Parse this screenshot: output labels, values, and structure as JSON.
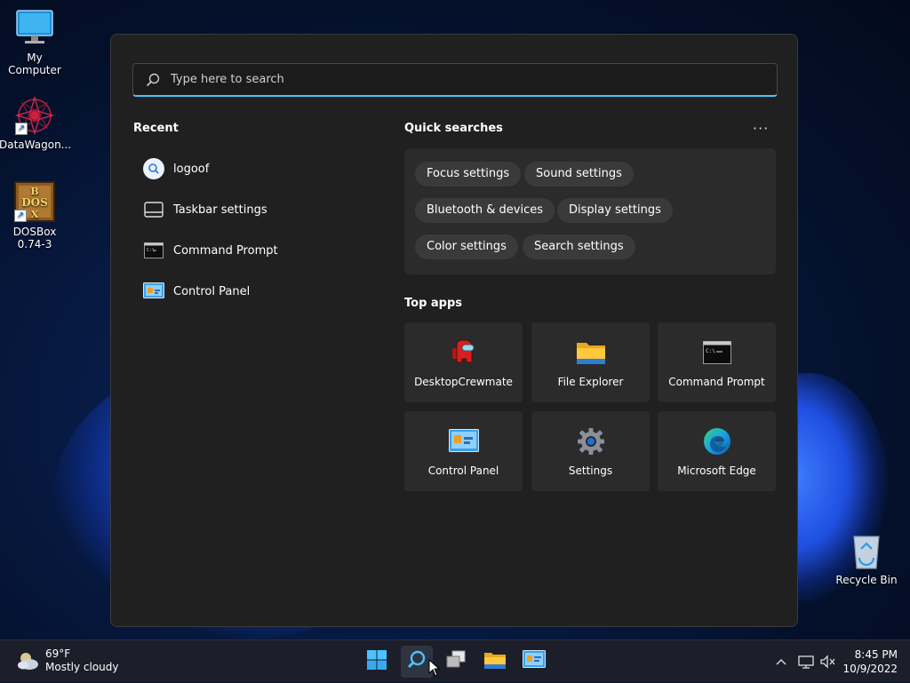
{
  "desktop": {
    "icons": [
      {
        "label": "My Computer"
      },
      {
        "label": "DataWagon..."
      },
      {
        "label": "DOSBox 0.74-3"
      },
      {
        "label": "Recycle Bin"
      }
    ],
    "dosbox_logo_letters": "BDOSX"
  },
  "search": {
    "placeholder": "Type here to search"
  },
  "recent": {
    "title": "Recent",
    "items": [
      {
        "label": "logoof",
        "icon": "search-icon"
      },
      {
        "label": "Taskbar settings",
        "icon": "taskbar-icon"
      },
      {
        "label": "Command Prompt",
        "icon": "command-prompt-icon"
      },
      {
        "label": "Control Panel",
        "icon": "control-panel-icon"
      }
    ]
  },
  "quick_searches": {
    "title": "Quick searches",
    "more": "···",
    "chips": [
      "Focus settings",
      "Sound settings",
      "Bluetooth & devices",
      "Display settings",
      "Color settings",
      "Search settings"
    ]
  },
  "top_apps": {
    "title": "Top apps",
    "apps": [
      {
        "label": "DesktopCrewmate",
        "icon": "crewmate-icon"
      },
      {
        "label": "File Explorer",
        "icon": "folder-icon"
      },
      {
        "label": "Command Prompt",
        "icon": "command-prompt-icon"
      },
      {
        "label": "Control Panel",
        "icon": "control-panel-icon"
      },
      {
        "label": "Settings",
        "icon": "gear-icon"
      },
      {
        "label": "Microsoft Edge",
        "icon": "edge-icon"
      }
    ]
  },
  "taskbar": {
    "weather_temp": "69°F",
    "weather_desc": "Mostly cloudy",
    "time": "8:45 PM",
    "date": "10/9/2022"
  },
  "colors": {
    "accent": "#4cc2ff",
    "panel": "#202020",
    "tile": "#2b2b2b"
  }
}
